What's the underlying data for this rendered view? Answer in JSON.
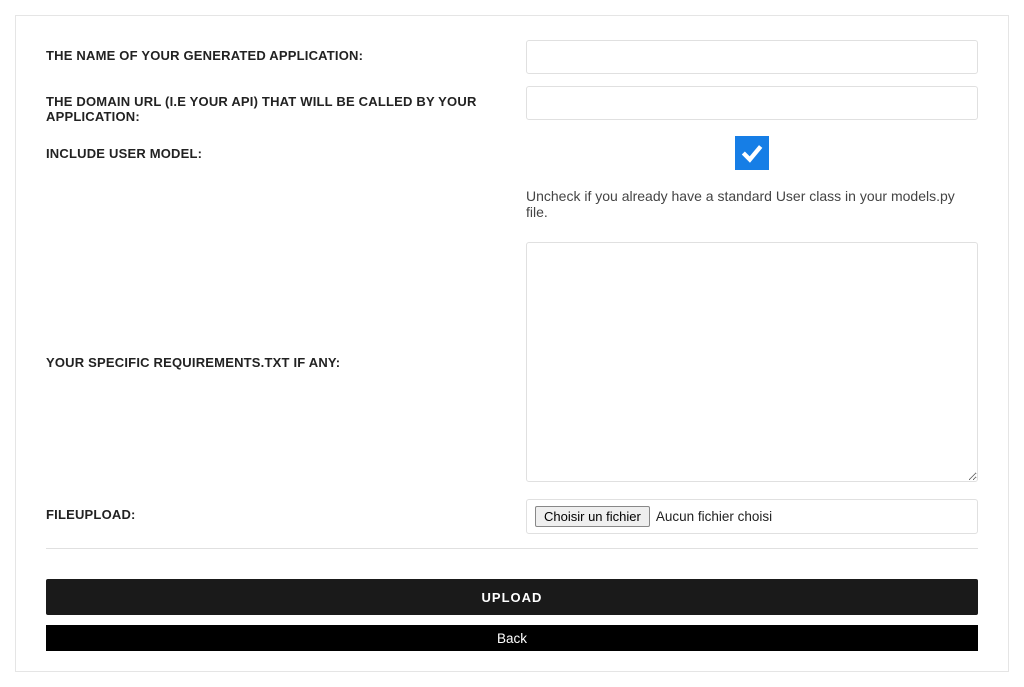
{
  "form": {
    "app_name": {
      "label": "The name of your generated application:",
      "value": ""
    },
    "domain_url": {
      "label": "The domain URL (i.e your API) that will be called by your application:",
      "value": ""
    },
    "include_user_model": {
      "label": "Include User model:",
      "checked": true,
      "help": "Uncheck if you already have a standard User class in your models.py file."
    },
    "requirements": {
      "label": "Your specific requirements.txt if any:",
      "value": ""
    },
    "fileupload": {
      "label": "Fileupload:",
      "button_text": "Choisir un fichier",
      "status_text": "Aucun fichier choisi"
    }
  },
  "buttons": {
    "upload": "Upload",
    "back": "Back"
  }
}
